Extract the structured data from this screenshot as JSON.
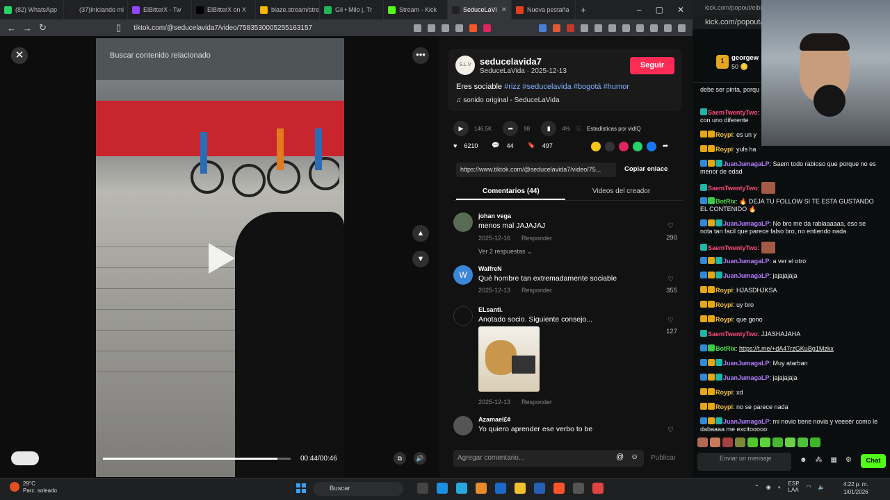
{
  "browser": {
    "tabs": [
      {
        "title": "(82) WhatsApp",
        "color": "#25d366",
        "active": false
      },
      {
        "title": "(37)Iniciando mi",
        "color": "#222222",
        "active": false
      },
      {
        "title": "ElBitterX - Tw",
        "color": "#9146ff",
        "active": false
      },
      {
        "title": "ElBitterX on X",
        "color": "#000000",
        "active": false
      },
      {
        "title": "blaze.stream/stre",
        "color": "#f5b800",
        "active": false
      },
      {
        "title": "Gil • Milo j, Tr",
        "color": "#1db954",
        "active": false
      },
      {
        "title": "Stream - Kick",
        "color": "#53fc18",
        "active": false
      },
      {
        "title": "SeduceLaVi",
        "color": "#222222",
        "active": true
      },
      {
        "title": "Nueva pestaña",
        "color": "#e2401d",
        "active": false
      }
    ],
    "url": "tiktok.com/@seducelavida7/video/7583530005255163157",
    "window_controls": [
      "–",
      "▢",
      "✕"
    ]
  },
  "video": {
    "search_placeholder": "Buscar contenido relacionado",
    "time": "00:44/00:46",
    "progress": 0.93
  },
  "post": {
    "avatar_text": "S.L.V",
    "username": "seducelavida7",
    "subline": "SeduceLaVida · 2025-12-13",
    "follow_label": "Seguir",
    "caption_text": "Eres sociable ",
    "caption_tags": "#rizz #seducelavida #bogotá #humor",
    "sound": "♫  sonido original - SeduceLaVida",
    "plays": "146.5K",
    "share_count": "98",
    "pct": "4%",
    "stats_label": "Estadísticas por vidIQ",
    "likes": "6210",
    "comments": "44",
    "saves": "497",
    "link": "https://www.tiktok.com/@seducelavida7/video/75...",
    "copy_label": "Copiar enlace",
    "tab_comments": "Comentarios (44)",
    "tab_videos": "Videos del creador",
    "comment_placeholder": "Agregar comentario...",
    "publish_label": "Publicar"
  },
  "comments": [
    {
      "user": "johan vega",
      "text": "menos mal JAJAJAJ",
      "date": "2025-12-16",
      "reply": "Responder",
      "likes": "290",
      "more": "Ver 2 respuestas ⌄",
      "avatar": "#5a6b55"
    },
    {
      "user": "WalfreN",
      "text": "Qué hombre tan extremadamente sociable",
      "date": "2025-12-13",
      "reply": "Responder",
      "likes": "355",
      "avatar": "#3c86d8",
      "initial": "W"
    },
    {
      "user": "ELsanti.",
      "text": "Anotado socio. Siguiente consejo...",
      "date": "2025-12-13",
      "reply": "Responder",
      "likes": "127",
      "avatar": "#111111"
    },
    {
      "user": "Azamael£¢",
      "text": "Yo quiero aprender ese verbo to be",
      "avatar": "#555555"
    }
  ],
  "chat": {
    "popout_url": "kick.com/popout/elbitterx",
    "popout_url2": "kick.com/popout/",
    "pinned_user": "georgew",
    "pinned_coins": "50 🪙",
    "pinned_rank": "1",
    "messages": [
      {
        "user": "",
        "text": "debe ser pinta, porqu",
        "color": "",
        "badges": ""
      },
      {
        "user": "SaemTwentyTwo",
        "text": "con uno diferente",
        "color": "pink",
        "badges": "t",
        "wrap": true
      },
      {
        "user": "Roypi",
        "text": "es un y",
        "color": "yel",
        "badges": "yy"
      },
      {
        "user": "Roypi",
        "text": "yuls ha",
        "color": "yel",
        "badges": "yy"
      },
      {
        "user": "JuanJumagaLP",
        "text": "Saem todo rabioso que porque no es menor de edad",
        "color": "pur",
        "badges": "byt"
      },
      {
        "user": "SaemTwentyTwo",
        "text": "",
        "color": "pink",
        "badges": "t",
        "emote": true
      },
      {
        "user": "BotRix",
        "text": "🔥 DEJA TU FOLLOW SI TE ESTA GUSTANDO EL CONTENIDO 🔥",
        "color": "grn",
        "badges": "bg"
      },
      {
        "user": "JuanJumagaLP",
        "text": "No bro me da rabiaaaaaa, eso se nota tan facil que parece falso bro, no entiendo nada",
        "color": "pur",
        "badges": "byt"
      },
      {
        "user": "SaemTwentyTwo",
        "text": "",
        "color": "pink",
        "badges": "t",
        "emote": true
      },
      {
        "user": "JuanJumagaLP",
        "text": "a ver el otro",
        "color": "pur",
        "badges": "byt"
      },
      {
        "user": "JuanJumagaLP",
        "text": "jajajajaja",
        "color": "pur",
        "badges": "byt"
      },
      {
        "user": "Roypi",
        "text": "HJASDHJKSA",
        "color": "yel",
        "badges": "yy"
      },
      {
        "user": "Roypi",
        "text": "uy bro",
        "color": "yel",
        "badges": "yy"
      },
      {
        "user": "Roypi",
        "text": "que gono",
        "color": "yel",
        "badges": "yy"
      },
      {
        "user": "SaemTwentyTwo",
        "text": "JJASHAJAHA",
        "color": "pink",
        "badges": "t"
      },
      {
        "user": "BotRix",
        "text": "https://t.me/+dA47rzGKuBg1Mzkx",
        "color": "grn",
        "badges": "bg",
        "link": true
      },
      {
        "user": "JuanJumagaLP",
        "text": "Muy atarban",
        "color": "pur",
        "badges": "byt"
      },
      {
        "user": "JuanJumagaLP",
        "text": "jajajajaja",
        "color": "pur",
        "badges": "byt"
      },
      {
        "user": "Roypi",
        "text": "xd",
        "color": "yel",
        "badges": "yy"
      },
      {
        "user": "Roypi",
        "text": "no se parece nada",
        "color": "yel",
        "badges": "yy"
      },
      {
        "user": "JuanJumagaLP",
        "text": "mi novio tiene novia y veeeer como le dabaaaa me excitooooo",
        "color": "pur",
        "badges": "byt"
      }
    ],
    "input_placeholder": "Enviar un mensaje",
    "chat_button": "Chat"
  },
  "taskbar": {
    "temp": "29°C",
    "weather": "Parc. soleado",
    "search": "Buscar",
    "lang": "ESP",
    "lang2": "LAA",
    "time": "4:22 p. m.",
    "date": "1/01/2026"
  }
}
